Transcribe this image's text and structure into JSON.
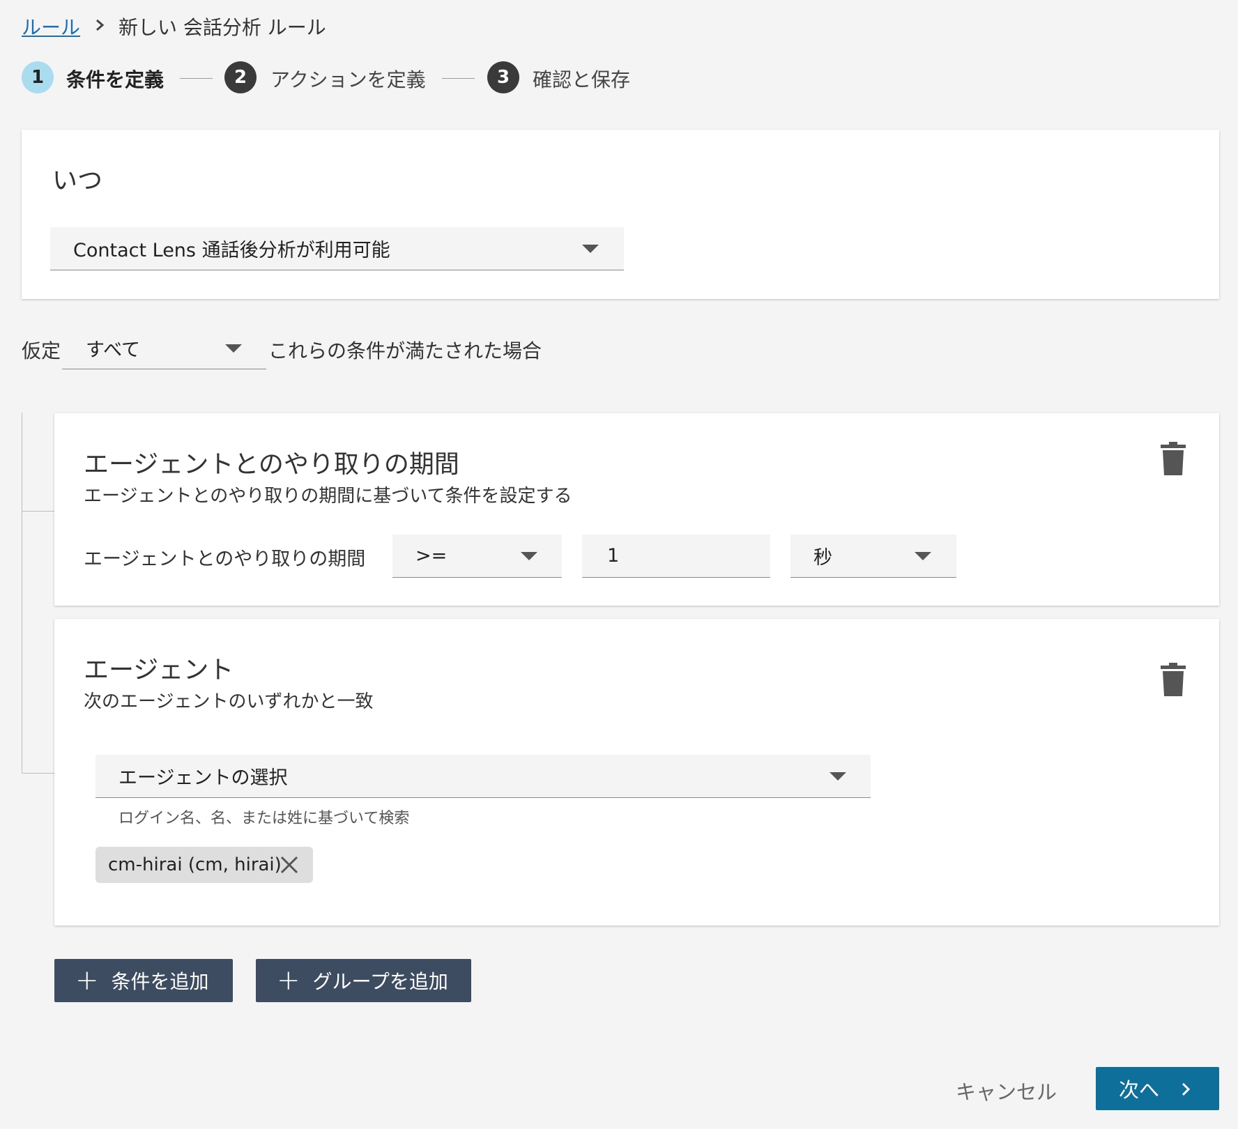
{
  "breadcrumb": {
    "root": "ルール",
    "current": "新しい 会話分析 ルール"
  },
  "stepper": {
    "steps": [
      {
        "number": "1",
        "label": "条件を定義",
        "state": "active"
      },
      {
        "number": "2",
        "label": "アクションを定義",
        "state": "idle"
      },
      {
        "number": "3",
        "label": "確認と保存",
        "state": "idle"
      }
    ]
  },
  "when_card": {
    "title": "いつ",
    "trigger_select": {
      "value": "Contact Lens 通話後分析が利用可能"
    }
  },
  "assume": {
    "prefix": "仮定",
    "match_select": {
      "value": "すべて"
    },
    "suffix": "これらの条件が満たされた場合"
  },
  "conditions": [
    {
      "title": "エージェントとのやり取りの期間",
      "subtitle": "エージェントとのやり取りの期間に基づいて条件を設定する",
      "field_label": "エージェントとのやり取りの期間",
      "operator": ">=",
      "amount": "1",
      "unit": "秒"
    },
    {
      "title": "エージェント",
      "subtitle": "次のエージェントのいずれかと一致",
      "agent_select": {
        "value": "エージェントの選択"
      },
      "hint": "ログイン名、名、または姓に基づいて検索",
      "chips": [
        "cm-hirai (cm, hirai)"
      ]
    }
  ],
  "actions": {
    "add_condition": "条件を追加",
    "add_group": "グループを追加"
  },
  "footer": {
    "cancel": "キャンセル",
    "next": "次へ"
  },
  "colors": {
    "link": "#1a6eb5",
    "active_step": "#a9dcef",
    "dark_button": "#3d4c61",
    "primary_button": "#0f6f9b"
  }
}
